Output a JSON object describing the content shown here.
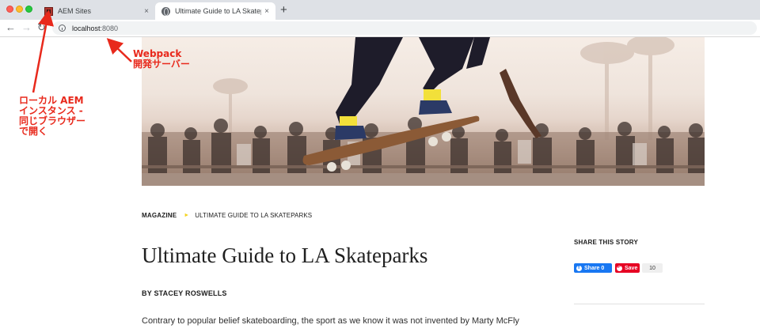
{
  "browser": {
    "tabs": [
      {
        "title": "AEM Sites",
        "close": "×",
        "favicon": "aem-favicon-icon",
        "active": false
      },
      {
        "title": "Ultimate Guide to LA Skateparks",
        "close": "×",
        "favicon": "globe-icon",
        "active": true
      }
    ],
    "new_tab": "+",
    "nav": {
      "back": "←",
      "forward": "→",
      "reload": "↻"
    },
    "url": {
      "host": "localhost",
      "port": ":8080"
    },
    "colors": {
      "tab_bar": "#dee1e6",
      "omnibox": "#f1f3f4"
    }
  },
  "page": {
    "breadcrumb": {
      "root": "MAGAZINE",
      "separator": "►",
      "current": "ULTIMATE GUIDE TO LA SKATEPARKS"
    },
    "title": "Ultimate Guide to LA Skateparks",
    "byline": "BY STACEY ROSWELLS",
    "body": "Contrary to popular belief skateboarding, the sport as we know it was not invented by Marty McFly",
    "share": {
      "heading": "SHARE THIS STORY",
      "facebook_label": "Share 0",
      "pinterest_label": "Save",
      "pinterest_count": "10"
    },
    "colors": {
      "accent_arrow": "#f4d31d",
      "facebook": "#1877f2",
      "pinterest": "#e60023"
    }
  },
  "annotations": {
    "webpack": "Webpack\n開発サーバー",
    "local_aem": "ローカル AEM\nインスタンス -\n同じブラウザー\nで開く",
    "color": "#e8291c"
  }
}
